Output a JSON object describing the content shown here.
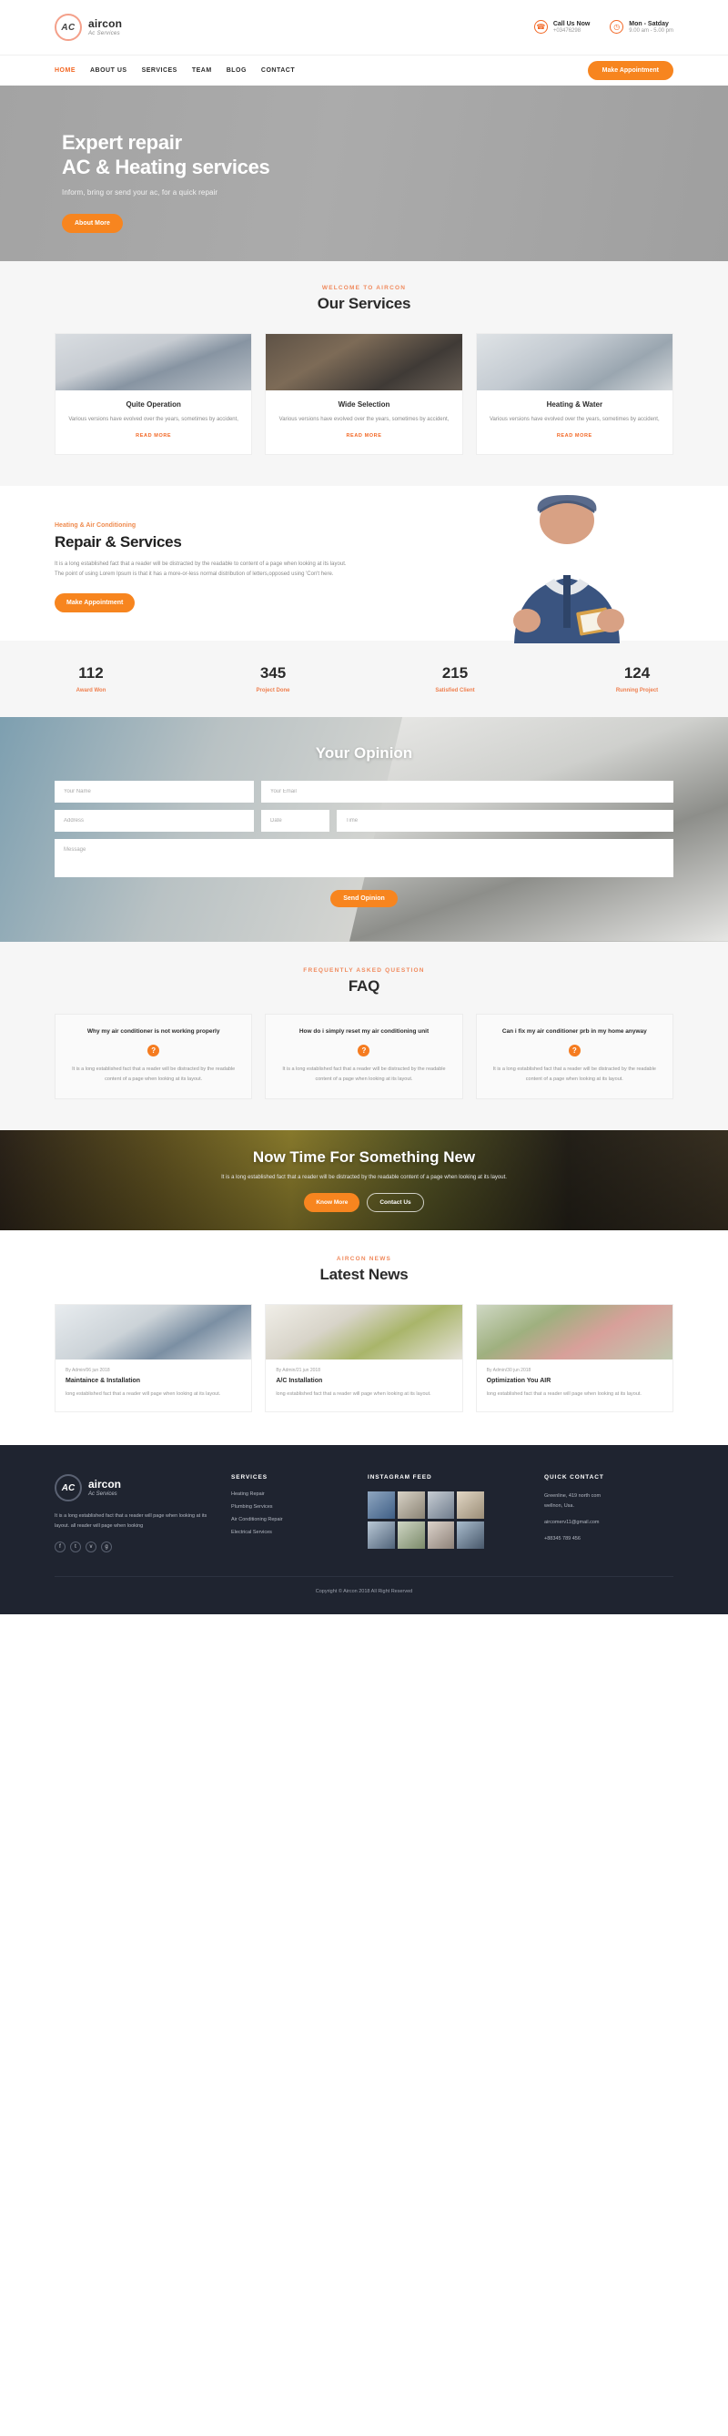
{
  "brand": {
    "mark": "AC",
    "name": "aircon",
    "tagline": "Ac Services"
  },
  "topbar": {
    "call": {
      "icon": "headset-icon",
      "title": "Call Us Now",
      "value": "+03476298"
    },
    "hours": {
      "icon": "clock-icon",
      "title": "Mon - Satday",
      "value": "9.00 am - 5.00 pm"
    }
  },
  "nav": {
    "items": [
      {
        "label": "HOME",
        "active": true
      },
      {
        "label": "ABOUT US",
        "active": false
      },
      {
        "label": "SERVICES",
        "active": false
      },
      {
        "label": "TEAM",
        "active": false
      },
      {
        "label": "BLOG",
        "active": false
      },
      {
        "label": "CONTACT",
        "active": false
      }
    ],
    "cta": "Make Appointment"
  },
  "hero": {
    "line1": "Expert repair",
    "line2": "AC & Heating services",
    "subtitle": "Inform, bring or send your ac, for a quick repair",
    "button": "About More"
  },
  "services": {
    "eyebrow": "WELCOME TO AIRCON",
    "title": "Our Services",
    "read_more": "READ MORE",
    "cards": [
      {
        "title": "Quite Operation",
        "text": "Various versions have evolved over the years, sometimes by accident,"
      },
      {
        "title": "Wide Selection",
        "text": "Various versions have evolved over the years, sometimes by accident,"
      },
      {
        "title": "Heating & Water",
        "text": "Various versions have evolved over the years, sometimes by accident,"
      }
    ]
  },
  "repair": {
    "eyebrow": "Heating & Air Conditioning",
    "title": "Repair & Services",
    "text": "It is a long established fact that a reader will be distracted by the readable to content of a page when looking at its layout. The point of using Lorem Ipsum is that it has a more-or-less normal distribution of letters,opposed using 'Con't here.",
    "button": "Make Appointment"
  },
  "stats": [
    {
      "number": "112",
      "label": "Award Won"
    },
    {
      "number": "345",
      "label": "Project Done"
    },
    {
      "number": "215",
      "label": "Satisfied Client"
    },
    {
      "number": "124",
      "label": "Running Project"
    }
  ],
  "opinion": {
    "title": "Your Opinion",
    "fields": {
      "name": "Your Name",
      "email": "Your Email",
      "address": "Address",
      "date": "Date",
      "time": "Time",
      "message": "Message"
    },
    "button": "Send Opinion"
  },
  "faq": {
    "eyebrow": "FREQUENTLY ASKED QUESTION",
    "title": "FAQ",
    "mark": "?",
    "cards": [
      {
        "question": "Why my air conditioner is not working properly",
        "answer": "It is a long established fact that a reader will be distracted by the readable content of a page when looking at its layout."
      },
      {
        "question": "How do i simply reset my air conditioning unit",
        "answer": "It is a long established fact that a reader will be distracted by the readable content of a page when looking at its layout."
      },
      {
        "question": "Can i fix my air conditioner prb in my home anyway",
        "answer": "It is a long established fact that a reader will be distracted by the readable content of a page when looking at its layout."
      }
    ]
  },
  "cta": {
    "title": "Now Time For Something New",
    "text": "It is a long established fact that a reader will be distracted by the readable content of a page when looking at its layout.",
    "primary": "Know More",
    "secondary": "Contact Us"
  },
  "news": {
    "eyebrow": "AIRCON NEWS",
    "title": "Latest News",
    "cards": [
      {
        "meta": "By Admin/06 jun 2018",
        "title": "Maintaince & Installation",
        "text": "long established fact that a reader will page when looking at its layout."
      },
      {
        "meta": "By Admin/21 jun 2018",
        "title": "A/C Installation",
        "text": "long established fact that a reader will page when looking at its layout."
      },
      {
        "meta": "By Admin/30 jun 2018",
        "title": "Optimization You AIR",
        "text": "long established fact that a reader will page when looking at its layout."
      }
    ]
  },
  "footer": {
    "about": "It is a long established fact that a reader will page when looking at its layout. all reader will page when looking",
    "socials": [
      "f",
      "t",
      "v",
      "g"
    ],
    "services": {
      "heading": "SERVICES",
      "items": [
        "Heating Repair",
        "Plumbing Services",
        "Air Conditioning Repair",
        "Electrical Services"
      ]
    },
    "instagram": {
      "heading": "INSTAGRAM FEED"
    },
    "contact": {
      "heading": "QUICK CONTACT",
      "address_line1": "Greenline, 419 north com",
      "address_line2": "wellnon, Usa.",
      "email": "aircomerv11@gmail.com",
      "phone": "+88345 789 456"
    },
    "copyright": "Copyright © Aircon 2018 All Right Reserved"
  },
  "colors": {
    "accent": "#f26724",
    "accent_btn": "#f7851f",
    "dark": "#1f2430"
  }
}
